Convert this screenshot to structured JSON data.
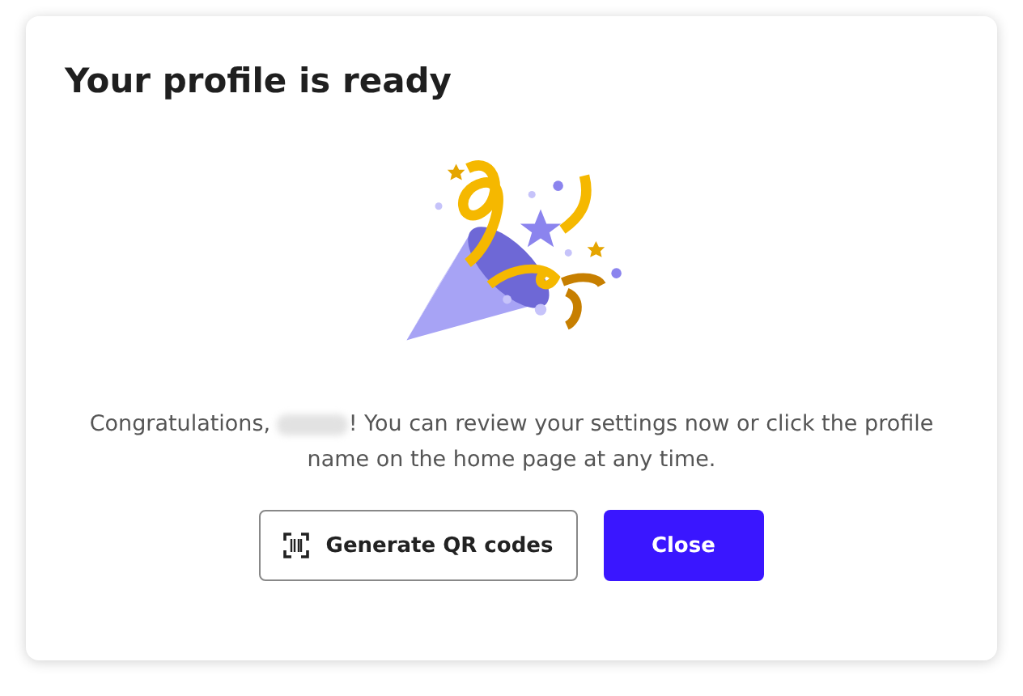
{
  "dialog": {
    "title": "Your profile is ready",
    "message": {
      "before": "Congratulations, ",
      "name_redacted": true,
      "after": "! You can review your settings now or click the profile name on the home page at any time."
    },
    "buttons": [
      {
        "label": "Generate QR codes",
        "kind": "secondary"
      },
      {
        "label": "Close",
        "kind": "primary"
      }
    ]
  }
}
